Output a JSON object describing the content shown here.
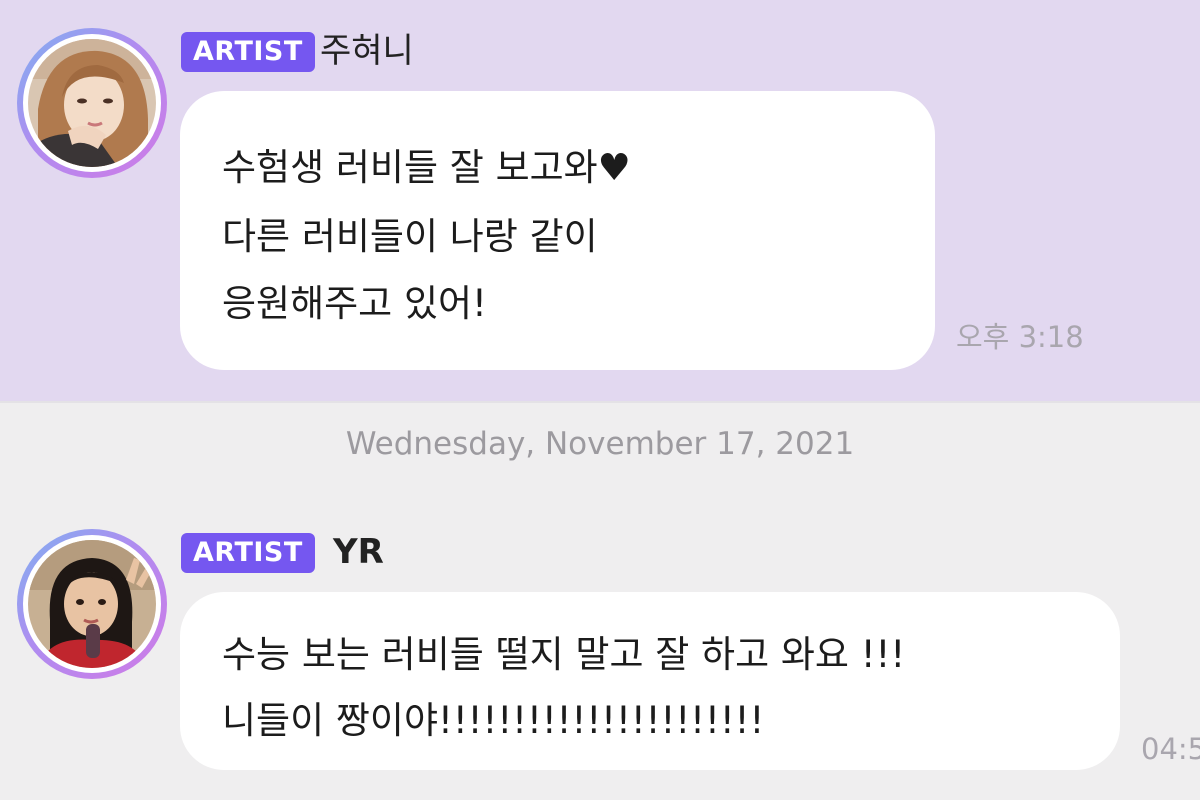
{
  "messages": [
    {
      "badge": "ARTIST",
      "sender": "주혀니",
      "lines": [
        "수험생 러비들 잘 보고와♥",
        "다른 러비들이 나랑 같이",
        "응원해주고 있어!"
      ],
      "time": "오후 3:18"
    },
    {
      "badge": "ARTIST",
      "sender": "YR",
      "lines": [
        "수능 보는 러비들 떨지 말고 잘 하고 와요 !!!",
        "니들이 짱이야!!!!!!!!!!!!!!!!!!!!!!"
      ],
      "time": "04:5"
    }
  ],
  "date_separator": "Wednesday, November 17, 2021",
  "colors": {
    "top_background": "#e2d8f0",
    "bottom_background": "#efeeef",
    "badge": "#7557f0",
    "bubble": "#ffffff",
    "timestamp": "#a9a6ae"
  }
}
